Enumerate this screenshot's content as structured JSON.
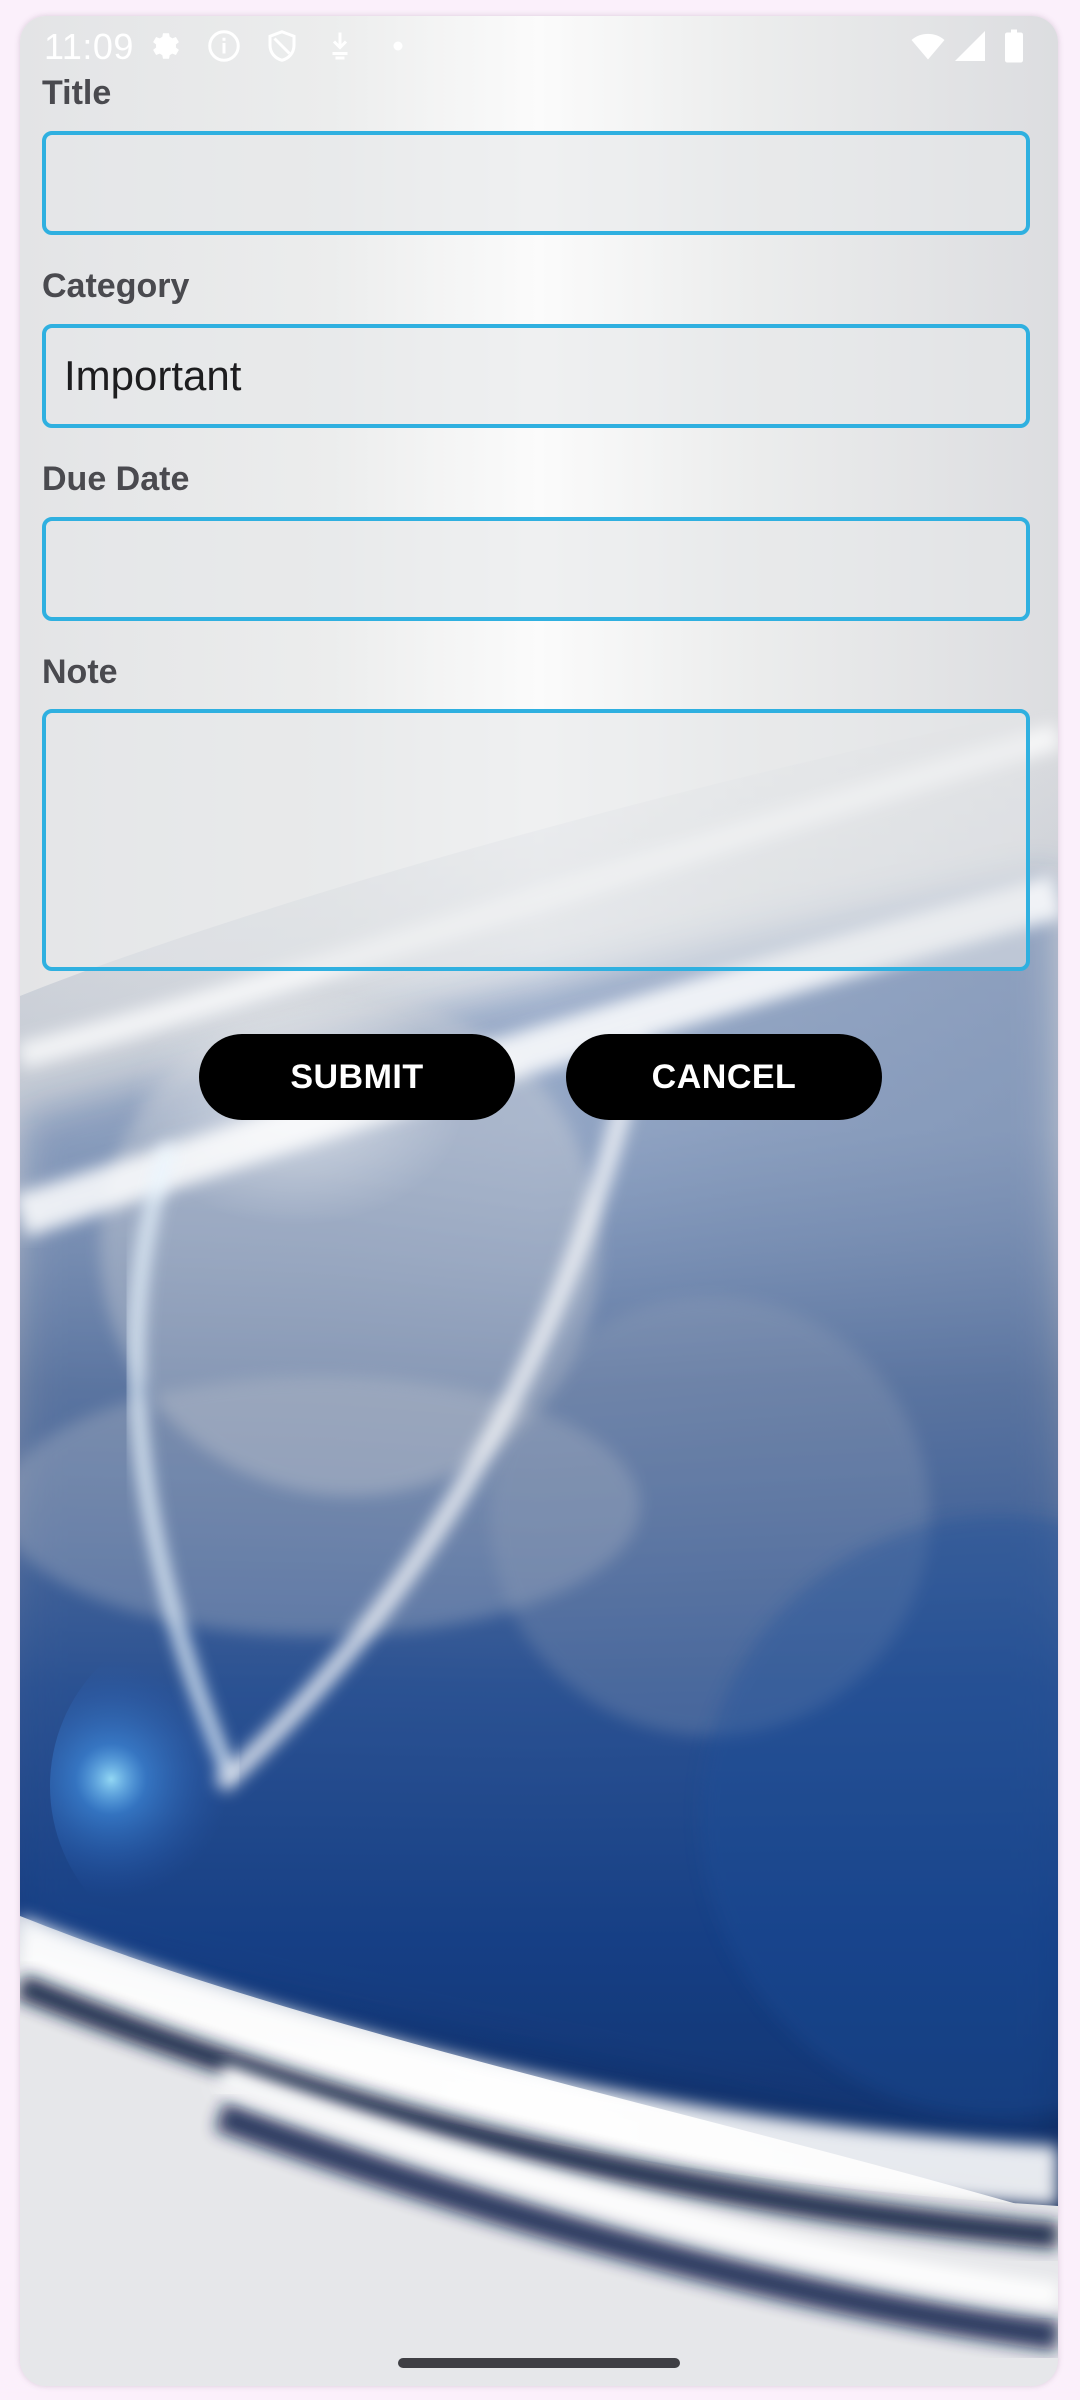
{
  "status_bar": {
    "time": "11:09",
    "icons": [
      "settings-icon",
      "info-icon",
      "shield-icon",
      "download-icon",
      "dot-icon",
      "wifi-icon",
      "signal-icon",
      "battery-icon"
    ]
  },
  "form": {
    "title": {
      "label": "Title",
      "value": ""
    },
    "category": {
      "label": "Category",
      "value": "Important"
    },
    "due_date": {
      "label": "Due Date",
      "value": ""
    },
    "note": {
      "label": "Note",
      "value": ""
    }
  },
  "buttons": {
    "submit_label": "SUBMIT",
    "cancel_label": "CANCEL"
  },
  "colors": {
    "field_border": "#2fb0e0",
    "button_bg": "#000000",
    "button_text": "#ffffff",
    "label_text": "#4a4a4f"
  }
}
